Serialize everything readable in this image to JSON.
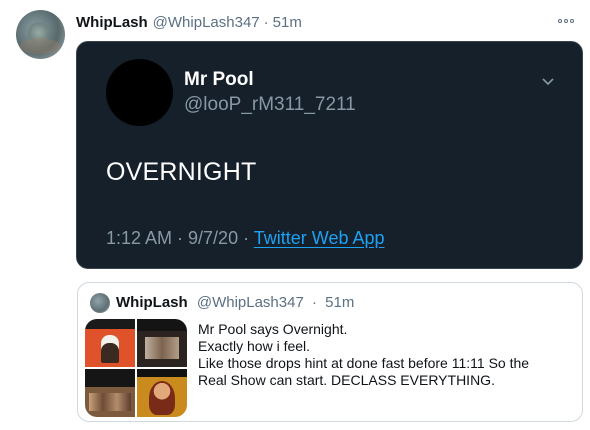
{
  "tweet": {
    "name": "WhipLash",
    "handle": "@WhipLash347",
    "separator": "·",
    "time": "51m"
  },
  "embed": {
    "name": "Mr Pool",
    "handle": "@looP_rM311_7211",
    "text": "OVERNIGHT",
    "datetime": "1:12 AM · 9/7/20 ·",
    "source": "Twitter Web App"
  },
  "quote": {
    "name": "WhipLash",
    "handle": "@WhipLash347",
    "separator": "·",
    "time": "51m",
    "lines": [
      "Mr Pool says Overnight.",
      "Exactly how i feel.",
      "Like those drops hint at done fast before 11:11 So the",
      "Real Show can start. DECLASS EVERYTHING."
    ]
  },
  "colors": {
    "dark_card": "#15202b",
    "link": "#1da1f2",
    "secondary_text": "#5b7083"
  }
}
